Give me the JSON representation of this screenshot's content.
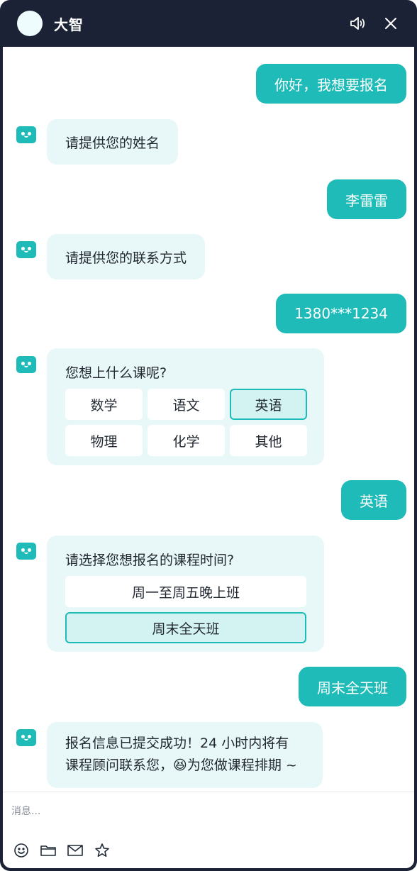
{
  "header": {
    "bot_name": "大智",
    "icons": [
      "speaker-icon",
      "close-icon"
    ]
  },
  "messages": [
    {
      "from": "user",
      "text": "你好，我想要报名"
    },
    {
      "from": "bot",
      "text": "请提供您的姓名"
    },
    {
      "from": "user",
      "text": "李雷雷"
    },
    {
      "from": "bot",
      "text": "请提供您的联系方式"
    },
    {
      "from": "user",
      "text": "1380***1234"
    },
    {
      "from": "bot",
      "question": "您想上什么课呢?",
      "options": [
        "数学",
        "语文",
        "英语",
        "物理",
        "化学",
        "其他"
      ],
      "selected": "英语"
    },
    {
      "from": "user",
      "text": "英语"
    },
    {
      "from": "bot",
      "question": "请选择您想报名的课程时间?",
      "options": [
        "周一至周五晚上班",
        "周末全天班"
      ],
      "selected": "周末全天班"
    },
    {
      "from": "user",
      "text": "周末全天班"
    },
    {
      "from": "bot",
      "line1": "报名信息已提交成功！24 小时内将有",
      "line2_before": "课程顾问联系您，",
      "emoji": "😆",
      "line2_after": "为您做课程排期 ~"
    }
  ],
  "composer": {
    "placeholder": "消息...",
    "tools": [
      "emoji-icon",
      "folder-icon",
      "mail-icon",
      "star-icon"
    ]
  },
  "colors": {
    "header_bg": "#1c2235",
    "accent": "#1fbbb9",
    "bot_bubble": "#e8f8f8",
    "selected_option": "#d3f3f2"
  }
}
